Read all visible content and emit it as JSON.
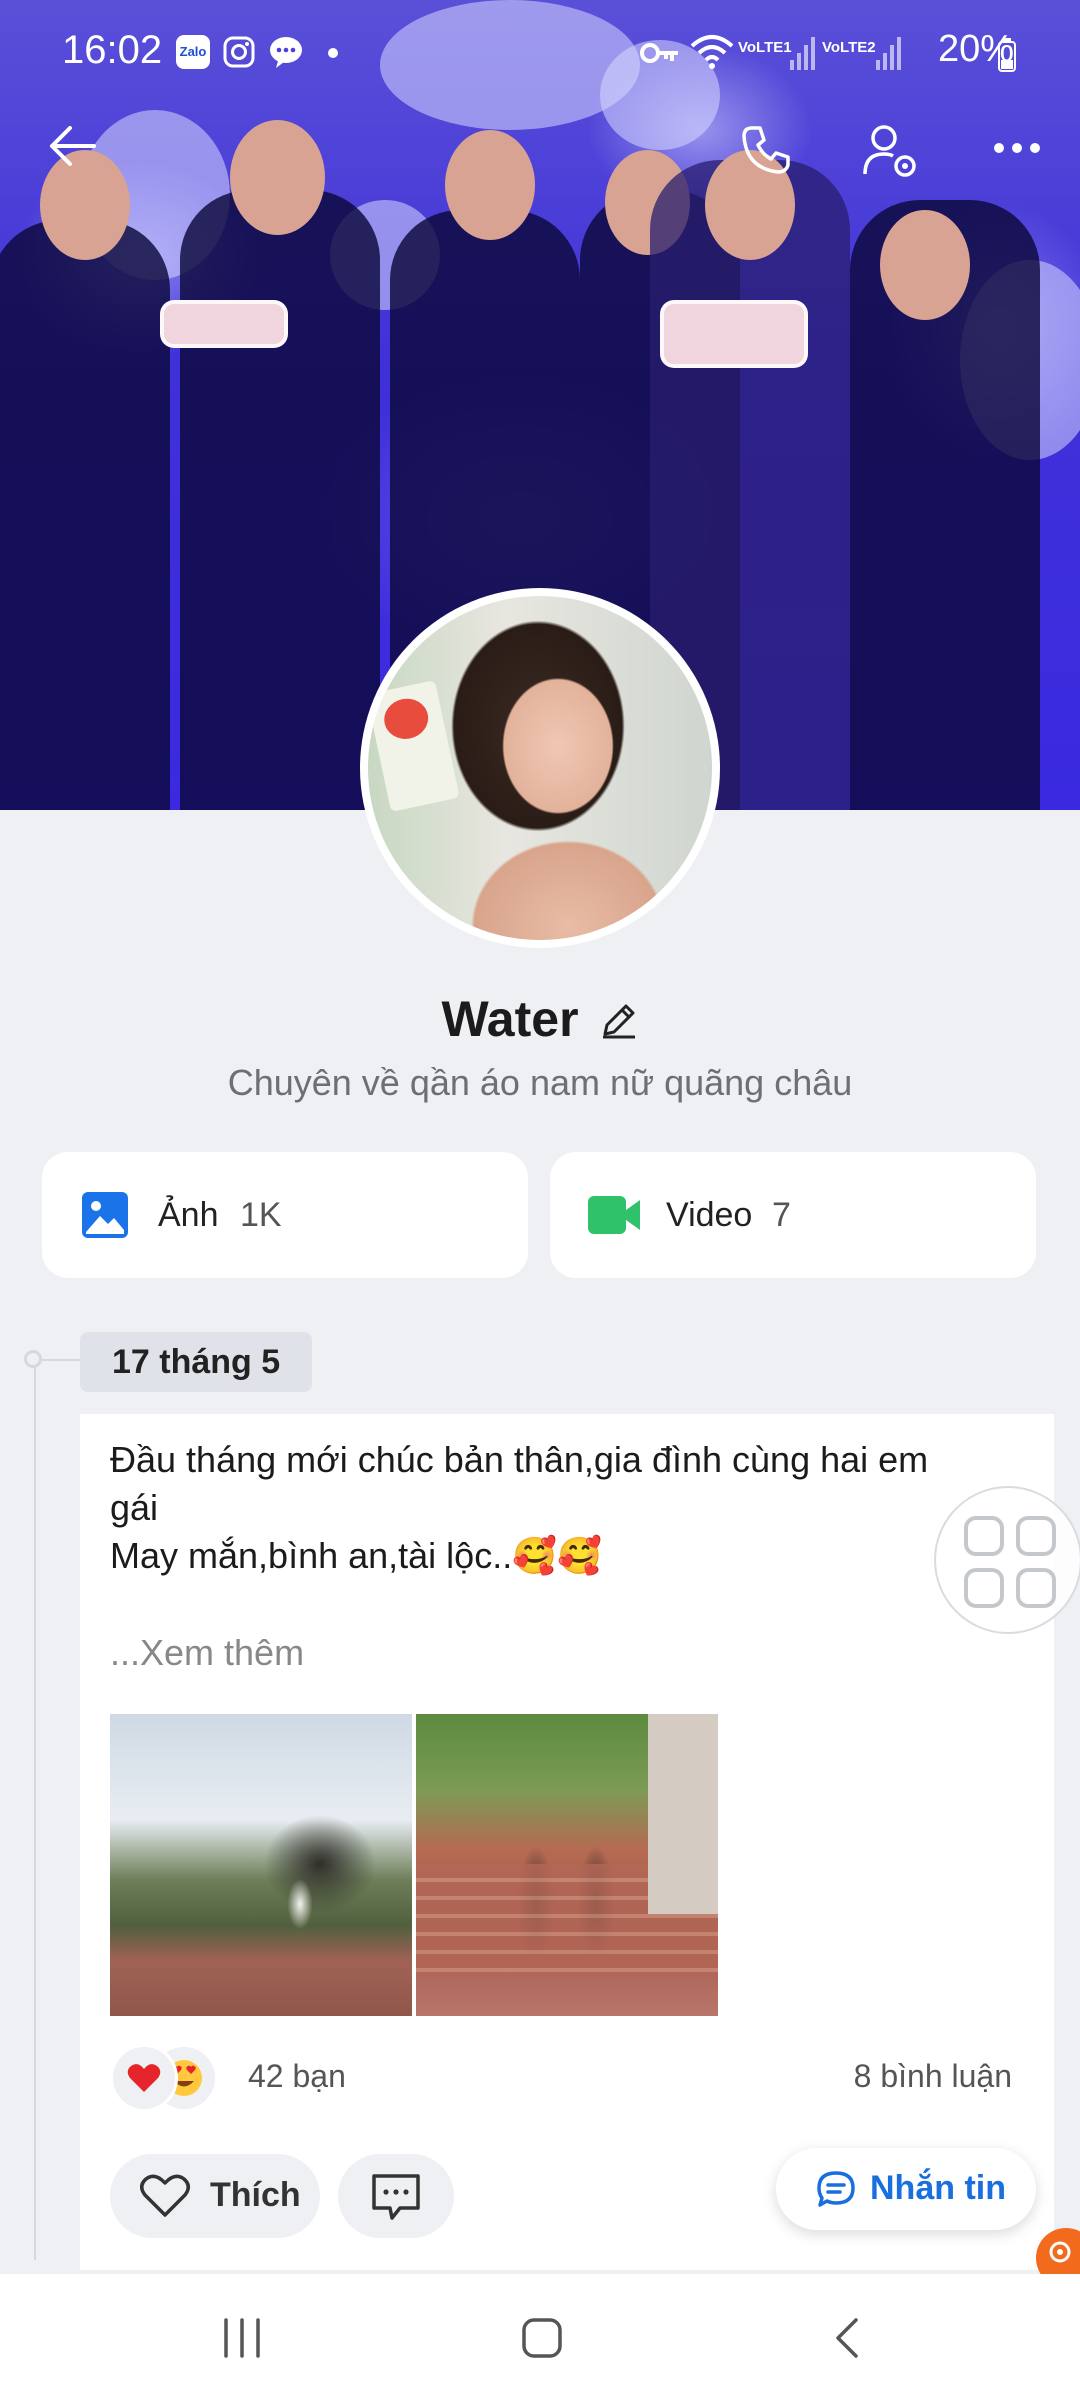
{
  "status_bar": {
    "time": "16:02",
    "app_icons": [
      "zalo-icon",
      "instagram-icon",
      "messenger-icon"
    ],
    "zalo_label": "Zalo",
    "signal_1": "VoLTE1",
    "signal_2": "VoLTE2",
    "battery": "20%"
  },
  "header": {
    "back_icon": "arrow-left-icon",
    "call_icon": "phone-icon",
    "settings_icon": "user-settings-icon",
    "more_icon": "more-horizontal-icon"
  },
  "profile": {
    "name": "Water",
    "bio": "Chuyên về qần áo nam nữ quãng châu"
  },
  "media": {
    "photos": {
      "label": "Ảnh",
      "count": "1K"
    },
    "videos": {
      "label": "Video",
      "count": "7"
    }
  },
  "timeline": {
    "date": "17 tháng 5",
    "post": {
      "lines": [
        "Đầu tháng mới chúc bản thân,gia đình cùng hai em",
        "gái",
        "May mắn,bình an,tài lộc..🥰🥰"
      ],
      "see_more": "...Xem thêm",
      "reaction_count": "42 bạn",
      "comment_count": "8 bình luận",
      "like_label": "Thích"
    }
  },
  "message_button": {
    "label": "Nhắn tin"
  },
  "colors": {
    "accent": "#1a6fe0",
    "video_green": "#2fc26b",
    "photo_blue": "#1a73e8",
    "badge_orange": "#f26a1b"
  }
}
